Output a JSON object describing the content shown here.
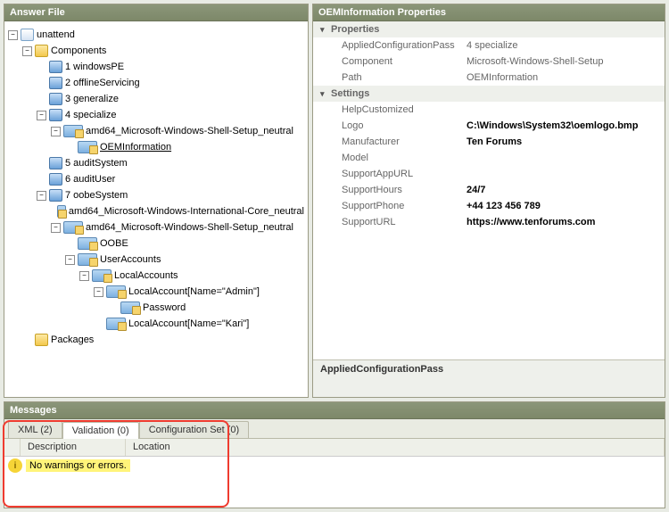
{
  "panels": {
    "answerFile": "Answer File",
    "properties": "OEMInformation Properties",
    "messages": "Messages"
  },
  "tree": {
    "root": "unattend",
    "components": "Components",
    "passes": {
      "p1": "1 windowsPE",
      "p2": "2 offlineServicing",
      "p3": "3 generalize",
      "p4": "4 specialize",
      "p5": "5 auditSystem",
      "p6": "6 auditUser",
      "p7": "7 oobeSystem"
    },
    "p4_items": {
      "shell": "amd64_Microsoft-Windows-Shell-Setup_neutral",
      "oem": "OEMInformation"
    },
    "p7_items": {
      "intl": "amd64_Microsoft-Windows-International-Core_neutral",
      "shell": "amd64_Microsoft-Windows-Shell-Setup_neutral",
      "oobe": "OOBE",
      "ua": "UserAccounts",
      "la": "LocalAccounts",
      "la_admin": "LocalAccount[Name=\"Admin\"]",
      "pwd": "Password",
      "la_kari": "LocalAccount[Name=\"Kari\"]"
    },
    "packages": "Packages"
  },
  "props": {
    "cat_properties": "Properties",
    "cat_settings": "Settings",
    "rows": {
      "acp_k": "AppliedConfigurationPass",
      "acp_v": "4 specialize",
      "comp_k": "Component",
      "comp_v": "Microsoft-Windows-Shell-Setup",
      "path_k": "Path",
      "path_v": "OEMInformation",
      "help_k": "HelpCustomized",
      "help_v": "",
      "logo_k": "Logo",
      "logo_v": "C:\\Windows\\System32\\oemlogo.bmp",
      "mfr_k": "Manufacturer",
      "mfr_v": "Ten Forums",
      "model_k": "Model",
      "model_v": "",
      "sau_k": "SupportAppURL",
      "sau_v": "",
      "sh_k": "SupportHours",
      "sh_v": "24/7",
      "sp_k": "SupportPhone",
      "sp_v": "+44 123 456 789",
      "su_k": "SupportURL",
      "su_v": "https://www.tenforums.com"
    },
    "footer": "AppliedConfigurationPass"
  },
  "messages": {
    "tabs": {
      "xml": "XML (2)",
      "validation": "Validation (0)",
      "config": "Configuration Set (0)"
    },
    "columns": {
      "desc": "Description",
      "loc": "Location"
    },
    "status": "No warnings or errors."
  }
}
